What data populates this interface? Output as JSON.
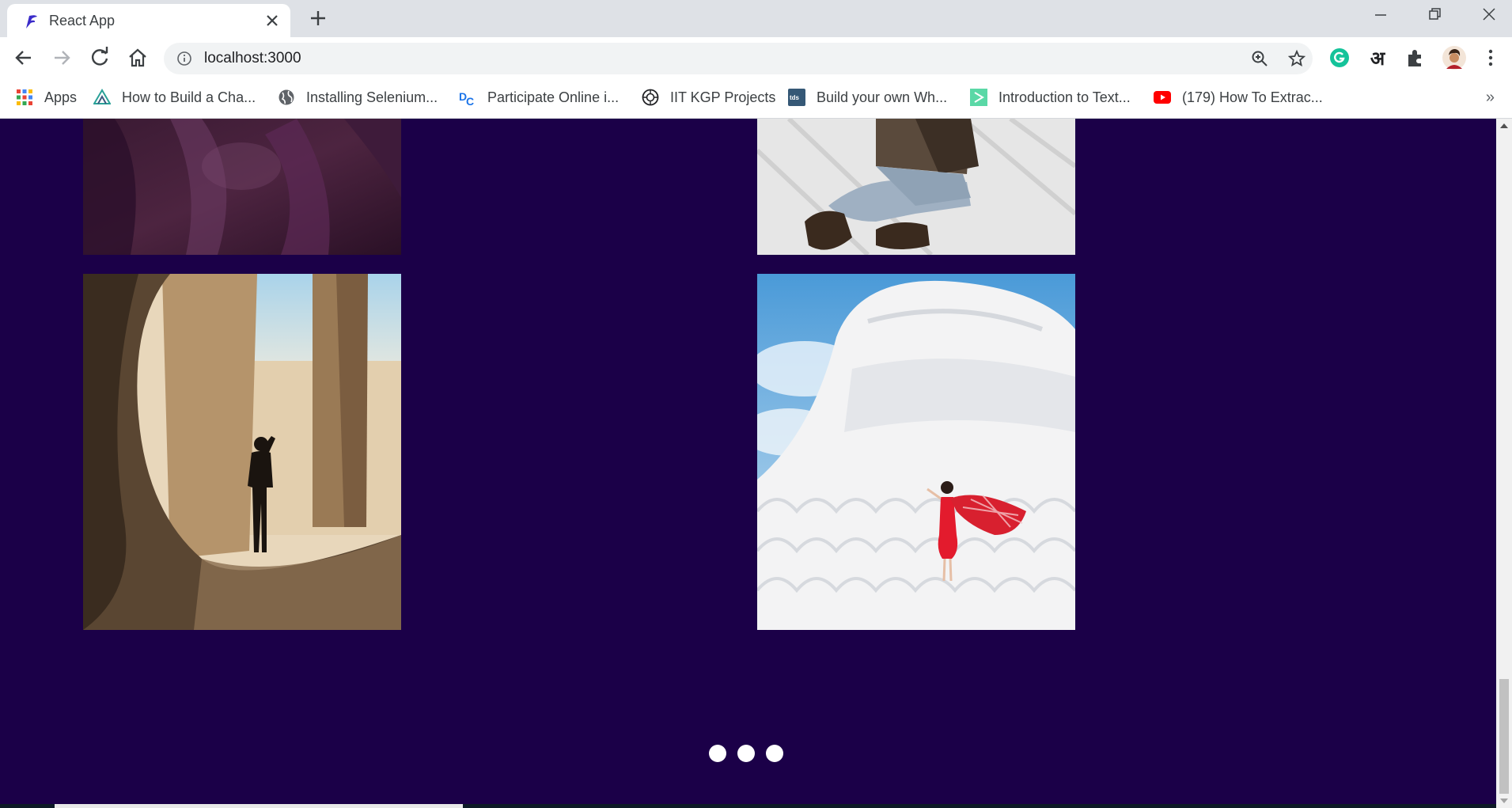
{
  "browser": {
    "tab": {
      "title": "React App",
      "favicon": "react-app-favicon"
    },
    "new_tab_icon": "plus-icon",
    "window_controls": [
      "minimize-icon",
      "restore-icon",
      "close-icon"
    ],
    "address": {
      "url": "localhost:3000",
      "info_icon": "info-icon"
    },
    "extension_labels": {
      "hindi": "अ"
    },
    "bookmarks": [
      {
        "label": "Apps",
        "icon": "apps-grid-icon"
      },
      {
        "label": "How to Build a Cha...",
        "icon": "vue-triangle-icon"
      },
      {
        "label": "Installing Selenium...",
        "icon": "globe-icon"
      },
      {
        "label": "Participate Online i...",
        "icon": "dc-logo-icon"
      },
      {
        "label": "IIT KGP Projects",
        "icon": "iit-emblem-icon"
      },
      {
        "label": "Build your own Wh...",
        "icon": "tds-icon"
      },
      {
        "label": "Introduction to Text...",
        "icon": "green-page-icon"
      },
      {
        "label": "(179) How To Extrac...",
        "icon": "youtube-icon"
      }
    ],
    "more_bookmarks": "»"
  },
  "gallery": {
    "background": "#1b0048",
    "photos": [
      {
        "name": "dark-purple-photo",
        "description": "cropped dark purple abstract photo"
      },
      {
        "name": "snow-sitting-person-photo",
        "description": "person in jeans and boots sitting on snow"
      },
      {
        "name": "ruins-silhouette-photo",
        "description": "silhouette of person photographing through stone ruins"
      },
      {
        "name": "white-pagoda-red-dress-photo",
        "description": "woman in red dress with red scarf on white pagoda"
      }
    ],
    "pagination_dots": 3
  }
}
